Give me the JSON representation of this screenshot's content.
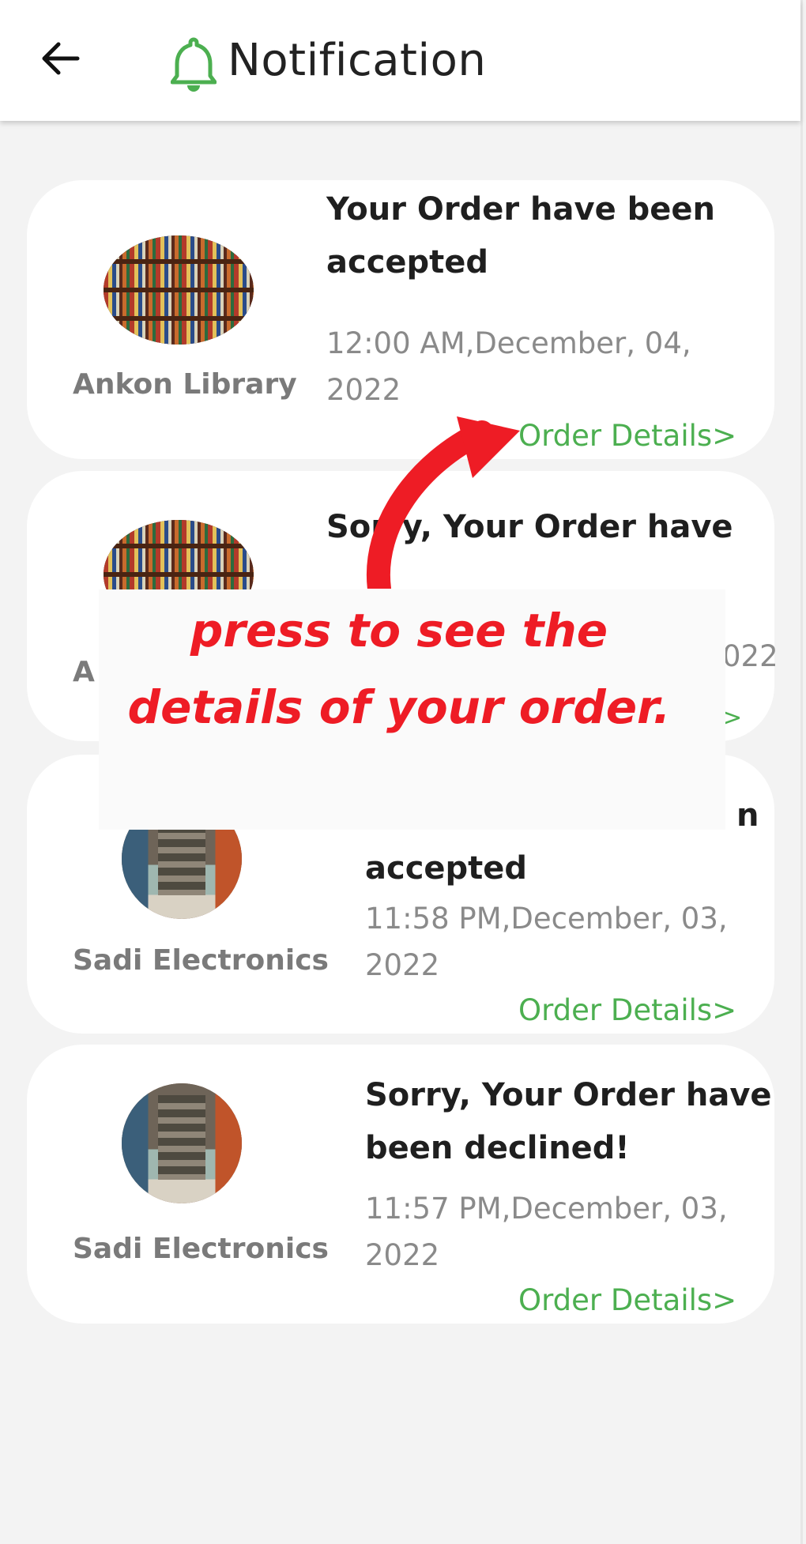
{
  "header": {
    "title": "Notification",
    "back_icon": "arrow-left-icon",
    "bell_icon": "bell-icon",
    "bell_color": "#4caf50"
  },
  "colors": {
    "accent_green": "#4caf50",
    "annotation_red": "#ee1c25"
  },
  "notifications": [
    {
      "shop": "Ankon Library",
      "image": "bookshelf",
      "message": "Your Order have been accepted",
      "time": "12:00 AM,December, 04, 2022",
      "link": "Order Details>"
    },
    {
      "shop": "Ankon Library",
      "image": "bookshelf",
      "message": "Sorry, Your Order have",
      "time_visible": "022",
      "link_visible": ">"
    },
    {
      "shop": "Sadi Electronics",
      "image": "electronics-store",
      "message_visible": "accepted",
      "message_fragment": "n",
      "time": "11:58 PM,December, 03, 2022",
      "link": "Order Details>"
    },
    {
      "shop": "Sadi Electronics",
      "image": "electronics-store",
      "message": "Sorry, Your Order have been declined!",
      "time": "11:57 PM,December, 03, 2022",
      "link": "Order Details>"
    }
  ],
  "annotation": {
    "line1": "press to see the",
    "line2": "details of your order.",
    "shop_fragment": "A"
  }
}
